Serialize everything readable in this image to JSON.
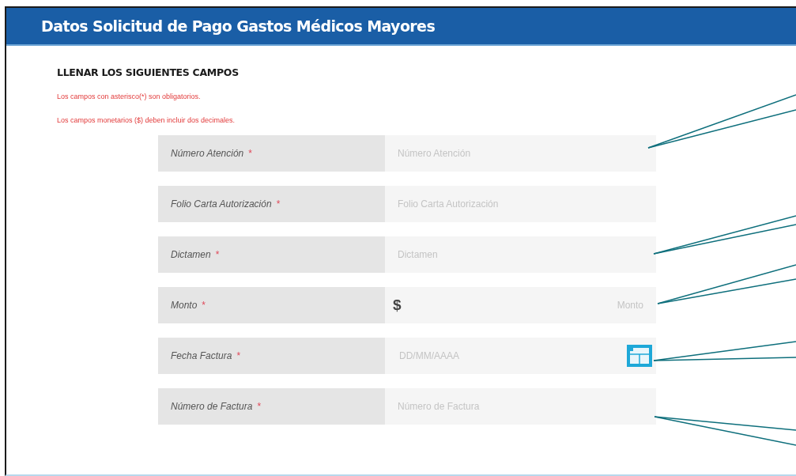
{
  "header": {
    "title": "Datos Solicitud de Pago Gastos Médicos Mayores"
  },
  "section": {
    "heading": "LLENAR LOS SIGUIENTES CAMPOS",
    "notes": [
      "Los campos con asterisco(*) son obligatorios.",
      "Los campos monetarios ($) deben incluir dos decimales."
    ]
  },
  "fields": [
    {
      "kind": "text",
      "label": "Número Atención",
      "required_mark": "*",
      "placeholder": "Número Atención"
    },
    {
      "kind": "text",
      "label": "Folio Carta Autorización",
      "required_mark": "*",
      "placeholder": "Folio Carta Autorización"
    },
    {
      "kind": "text",
      "label": "Dictamen",
      "required_mark": "*",
      "placeholder": "Dictamen"
    },
    {
      "kind": "currency",
      "label": "Monto",
      "required_mark": "*",
      "placeholder": "Monto",
      "prefix": "$"
    },
    {
      "kind": "date",
      "label": "Fecha Factura",
      "required_mark": "*",
      "placeholder": "DD/MM/AAAA"
    },
    {
      "kind": "text",
      "label": "Número de Factura",
      "required_mark": "*",
      "placeholder": "Número de Factura"
    }
  ]
}
